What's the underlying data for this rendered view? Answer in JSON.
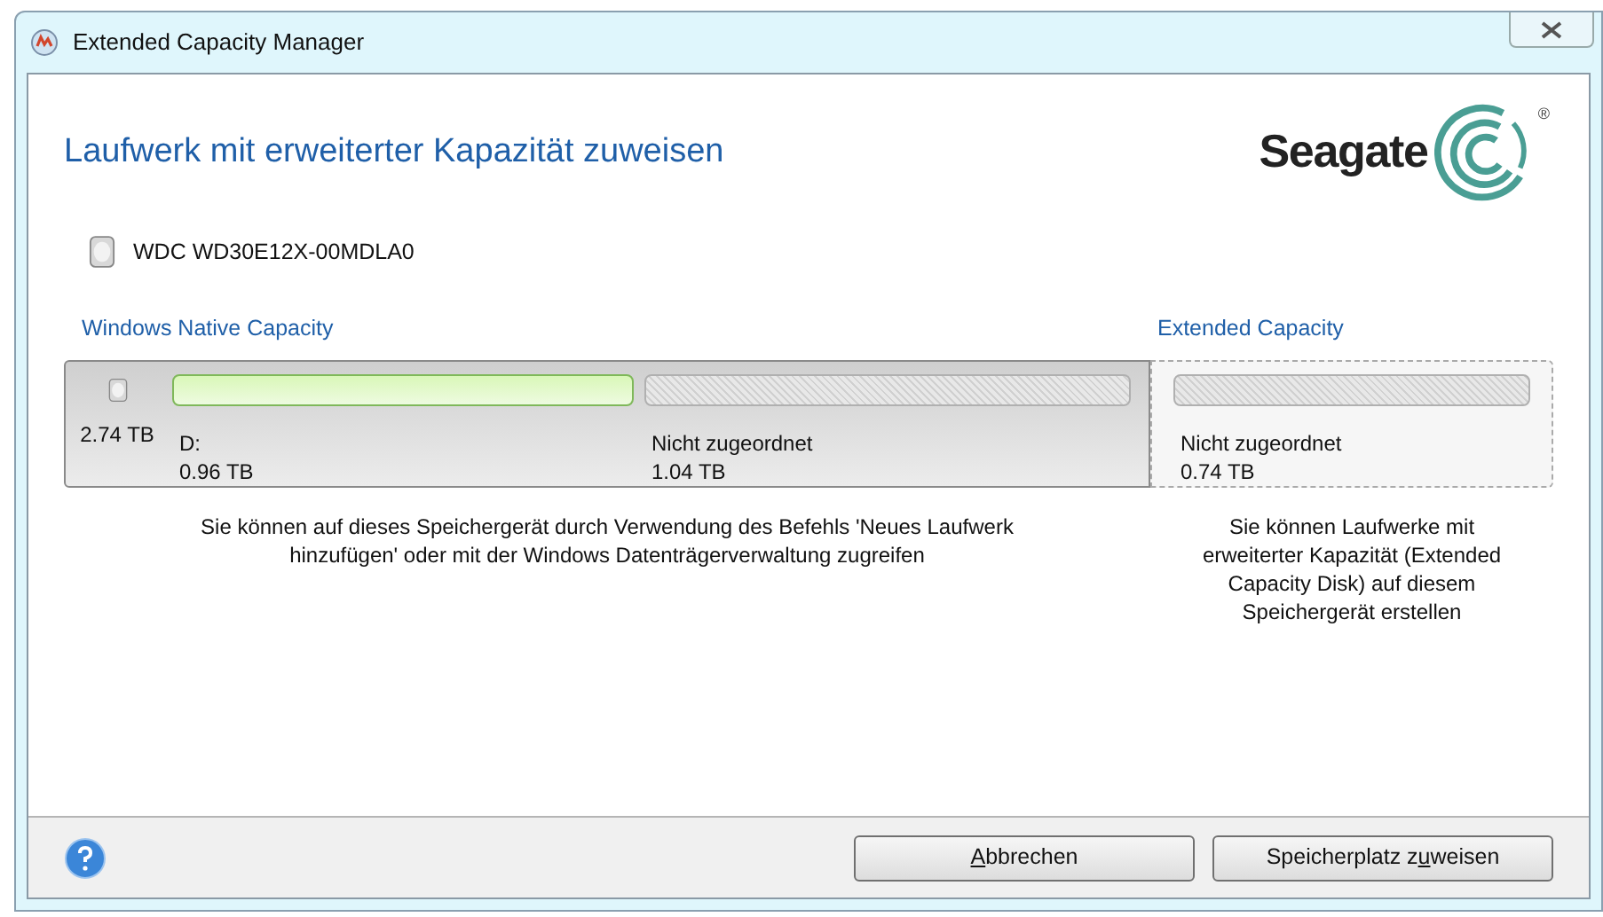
{
  "window": {
    "title": "Extended Capacity Manager"
  },
  "heading": "Laufwerk mit erweiterter Kapazität zuweisen",
  "logo": {
    "wordmark": "Seagate",
    "registered": "®"
  },
  "disk": {
    "name": "WDC WD30E12X-00MDLA0"
  },
  "native": {
    "label": "Windows Native Capacity",
    "total": "2.74 TB",
    "partitions": [
      {
        "kind": "partition",
        "name": "D:",
        "size": "0.96 TB"
      },
      {
        "kind": "unallocated",
        "name": "Nicht zugeordnet",
        "size": "1.04 TB"
      }
    ],
    "note": "Sie können auf dieses Speichergerät durch Verwendung des Befehls 'Neues Laufwerk hinzufügen' oder mit der Windows Datenträgerverwaltung zugreifen"
  },
  "extended": {
    "label": "Extended Capacity",
    "partitions": [
      {
        "kind": "unallocated",
        "name": "Nicht zugeordnet",
        "size": "0.74 TB"
      }
    ],
    "note": "Sie können Laufwerke mit erweiterter Kapazität (Extended Capacity Disk) auf diesem Speichergerät erstellen"
  },
  "buttons": [
    {
      "label_parts": [
        {
          "text": "A",
          "underlined": true
        },
        {
          "text": "bbrechen",
          "underlined": false
        }
      ]
    },
    {
      "label_parts": [
        {
          "text": "Speicherplatz z",
          "underlined": false
        },
        {
          "text": "u",
          "underlined": true
        },
        {
          "text": "weisen",
          "underlined": false
        }
      ]
    }
  ]
}
